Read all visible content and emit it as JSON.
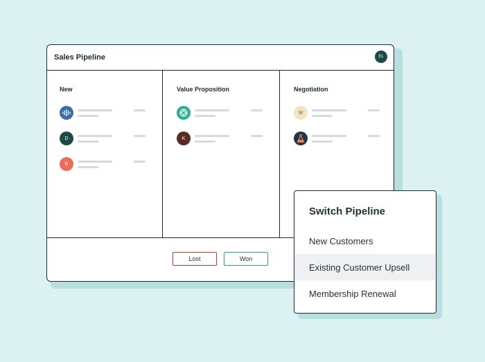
{
  "window": {
    "title": "Sales Pipeline",
    "user_initials": "EL"
  },
  "columns": [
    {
      "title": "New",
      "deals": [
        {
          "icon": "waveform-icon",
          "color": "#3a6ea8"
        },
        {
          "initial": "D",
          "color": "#1d4a45"
        },
        {
          "initial": "B",
          "color": "#ee6e55"
        }
      ]
    },
    {
      "title": "Value Proposition",
      "deals": [
        {
          "icon": "target-icon",
          "color": "#2bb08e"
        },
        {
          "initial": "K",
          "color": "#5a2a24"
        }
      ]
    },
    {
      "title": "Negotiation",
      "deals": [
        {
          "initial": "W",
          "color": "#f3e4c5"
        },
        {
          "icon": "flask-icon",
          "color": "#223448"
        }
      ]
    }
  ],
  "footer": {
    "lost_label": "Lost",
    "won_label": "Won"
  },
  "popup": {
    "title": "Switch Pipeline",
    "items": [
      "New Customers",
      "Existing Customer Upsell",
      "Membership Renewal"
    ],
    "highlighted_index": 1
  }
}
